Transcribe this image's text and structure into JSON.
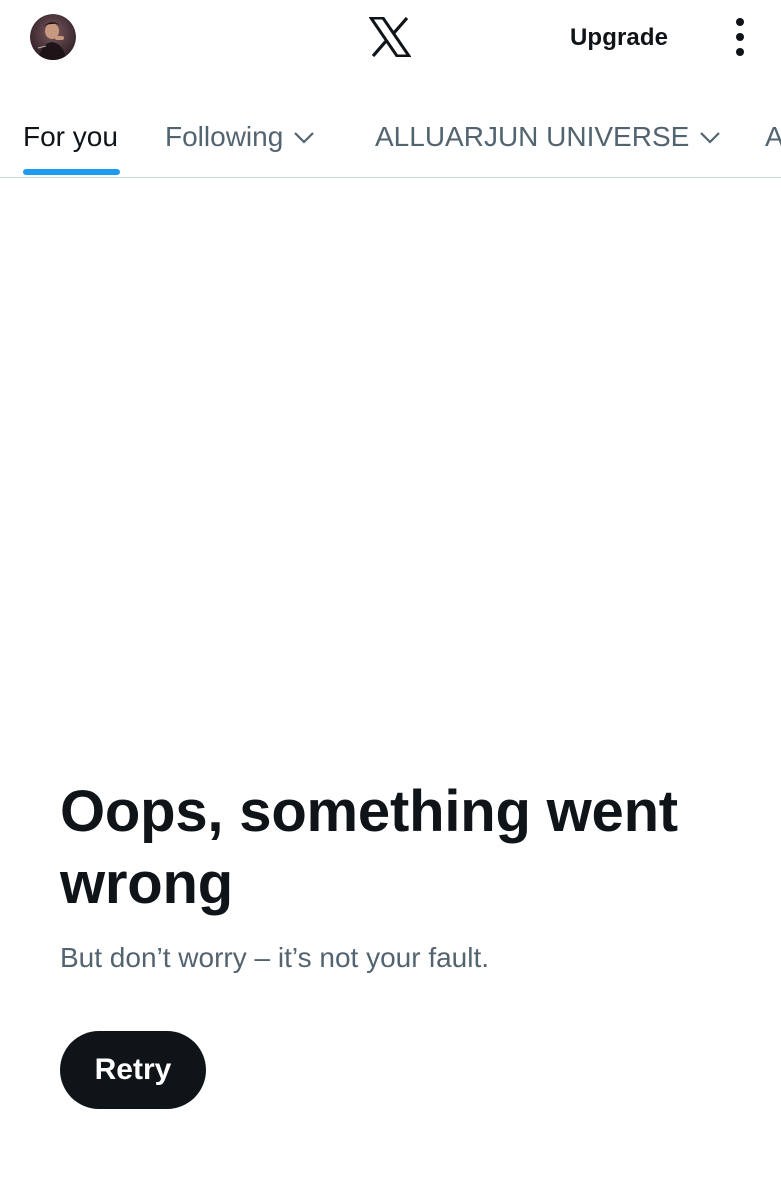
{
  "header": {
    "upgrade_label": "Upgrade",
    "logo_icon": "x-logo-icon",
    "more_icon": "more-vertical-icon"
  },
  "tabs": [
    {
      "label": "For you",
      "active": true
    },
    {
      "label": "Following",
      "active": false,
      "dropdown": true
    },
    {
      "label": "ALLUARJUN UNIVERSE",
      "active": false,
      "dropdown": true
    },
    {
      "label": "A",
      "active": false
    }
  ],
  "error": {
    "title": "Oops, something went wrong",
    "message": "But don’t worry – it’s not your fault.",
    "retry_label": "Retry"
  },
  "colors": {
    "accent": "#1d9bf0",
    "text_primary": "#0f1419",
    "text_secondary": "#536471",
    "divider": "#cfd9de"
  }
}
